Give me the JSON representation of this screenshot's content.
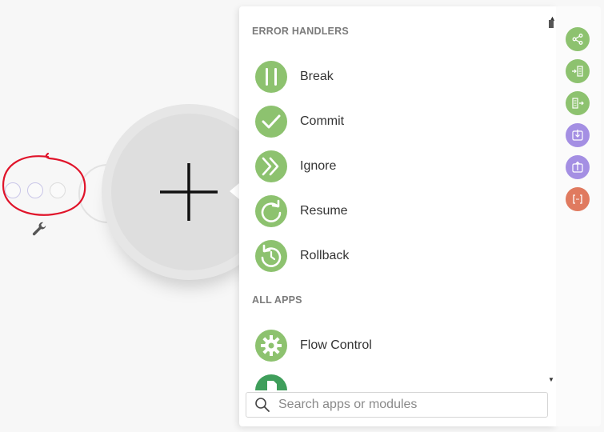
{
  "panel": {
    "sections": [
      {
        "title": "ERROR HANDLERS"
      },
      {
        "title": "ALL APPS"
      }
    ],
    "items": [
      {
        "label": "Break",
        "icon": "pause-icon"
      },
      {
        "label": "Commit",
        "icon": "check-icon"
      },
      {
        "label": "Ignore",
        "icon": "double-chevron-icon"
      },
      {
        "label": "Resume",
        "icon": "redo-icon"
      },
      {
        "label": "Rollback",
        "icon": "undo-icon"
      },
      {
        "label": "Flow Control",
        "icon": "gear-icon"
      }
    ],
    "search": {
      "placeholder": "Search apps or modules",
      "value": ""
    }
  },
  "toolbar": {
    "buttons": [
      {
        "icon": "share-icon",
        "color": "#8dc26f"
      },
      {
        "icon": "import-list-icon",
        "color": "#8dc26f"
      },
      {
        "icon": "export-list-icon",
        "color": "#8dc26f"
      },
      {
        "icon": "download-box-icon",
        "color": "#a48fe3"
      },
      {
        "icon": "upload-box-icon",
        "color": "#a48fe3"
      },
      {
        "icon": "brackets-icon",
        "color": "#e07a5f"
      }
    ]
  },
  "colors": {
    "accent_green": "#8dc26f",
    "accent_purple": "#a48fe3",
    "accent_orange": "#e07a5f",
    "annotation_red": "#e0142a"
  }
}
